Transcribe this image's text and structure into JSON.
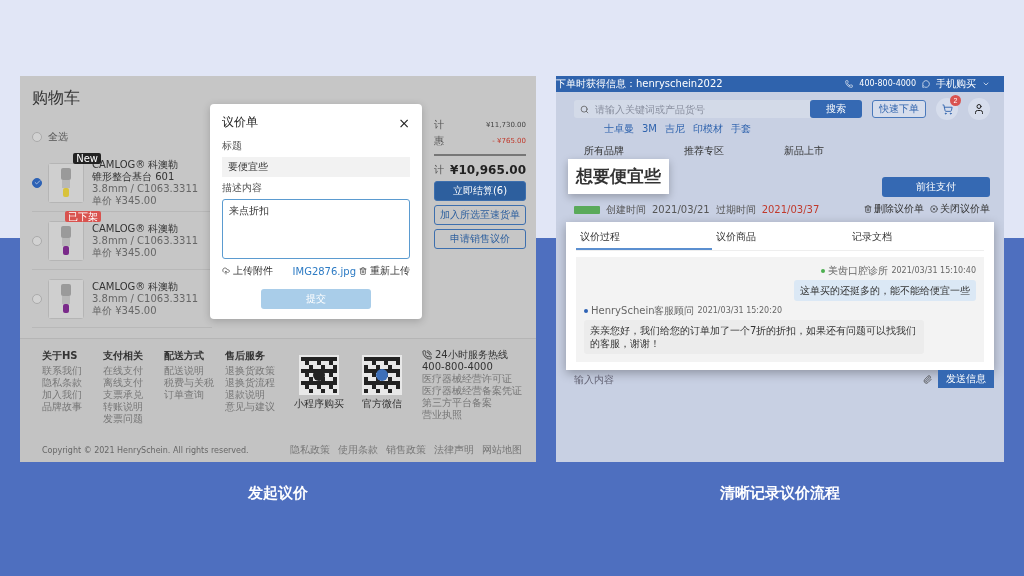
{
  "cart_screen": {
    "title": "购物车",
    "select_all": {
      "label": "全选",
      "checked": false
    },
    "products": [
      {
        "badge": {
          "text": "New",
          "color": "#222222"
        },
        "checked": true,
        "name": "CAMLOG® 科澳勒",
        "model": "锥形整合基台 601",
        "spec": "3.8mm / C1063.3311",
        "price": "单价 ¥345.00"
      },
      {
        "badge": {
          "text": "已下架",
          "color": "#d9534f"
        },
        "checked": false,
        "name": "CAMLOG® 科澳勒",
        "spec": "3.8mm / C1063.3311",
        "price": "单价 ¥345.00"
      },
      {
        "checked": false,
        "name": "CAMLOG® 科澳勒",
        "spec": "3.8mm / C1063.3311",
        "price": "单价 ¥345.00"
      }
    ],
    "summary": {
      "rows": [
        {
          "label": "计",
          "value": "¥11,730.00",
          "kind": "normal"
        },
        {
          "label": "惠",
          "value": "- ¥765.00",
          "kind": "discount"
        }
      ],
      "total_label": "计",
      "total": "¥10,965.00"
    },
    "buttons": [
      {
        "label": "立即结算(6)",
        "kind": "primary"
      },
      {
        "label": "加入所选至速货单",
        "kind": "outline"
      },
      {
        "label": "申请销售议价",
        "kind": "outline"
      }
    ],
    "dialog": {
      "title": "议价单",
      "close": "×",
      "title_label": "标题",
      "title_value": "要便宜些",
      "desc_label": "描述内容",
      "desc_value": "来点折扣",
      "upload": "上传附件",
      "file": "IMG2876.jpg",
      "reupload": "重新上传",
      "submit": {
        "label": "提交",
        "disabled": true
      }
    },
    "footer": {
      "columns": [
        {
          "heading": "关于HS",
          "links": [
            "联系我们",
            "隐私条款",
            "加入我们",
            "品牌故事"
          ]
        },
        {
          "heading": "支付相关",
          "links": [
            "在线支付",
            "离线支付",
            "支票承兑",
            "转账说明",
            "发票问题"
          ]
        },
        {
          "heading": "配送方式",
          "links": [
            "配送说明",
            "税费与关税",
            "订单查询"
          ]
        },
        {
          "heading": "售后服务",
          "links": [
            "退换货政策",
            "退换货流程",
            "退款说明",
            "意见与建议"
          ]
        }
      ],
      "qr_codes": [
        {
          "label": "小程序购买"
        },
        {
          "label": "官方微信"
        }
      ],
      "hotline": {
        "label": "24小时服务热线",
        "number": "400-800-4000",
        "links": [
          "医疗器械经营许可证",
          "医疗器械经营备案凭证",
          "第三方平台备案",
          "营业执照"
        ]
      },
      "copyright": "Copyright © 2021 HenrySchein. All rights reserved.",
      "legal_links": [
        "隐私政策",
        "使用条款",
        "销售政策",
        "法律声明",
        "网站地图"
      ]
    }
  },
  "negotiation_screen": {
    "top_bar": {
      "notice": "下单时获得信息：henryschein2022",
      "phone": "400-800-4000",
      "mobile": "手机购买"
    },
    "search": {
      "placeholder": "请输入关键词或产品货号",
      "button": "搜索"
    },
    "hot_words": [
      "士卓曼",
      "3M",
      "吉尼",
      "印模材",
      "手套"
    ],
    "quick_order": "快速下单",
    "cart_count": "2",
    "nav": [
      "所有品牌",
      "推荐专区",
      "新品上市"
    ],
    "callout": "想要便宜些",
    "created": {
      "label": "创建时间",
      "value": "2021/03/21"
    },
    "expires": {
      "label": "过期时间",
      "value": "2021/03/37"
    },
    "pay_button": "前往支付",
    "actions": [
      {
        "label": "删除议价单",
        "kind": "delete"
      },
      {
        "label": "关闭议价单",
        "kind": "close"
      }
    ],
    "tabs": [
      {
        "label": "议价过程",
        "selected": true
      },
      {
        "label": "议价商品",
        "selected": false
      },
      {
        "label": "记录文档",
        "selected": false
      }
    ],
    "messages": [
      {
        "kind": "sent",
        "color": "#4caf50",
        "sender": "美齿口腔诊所",
        "time": "2021/03/31 15:10:40",
        "text": "这单买的还挺多的，能不能给便宜一些"
      },
      {
        "kind": "received",
        "color": "#2d62b5",
        "sender": "HenrySchein客服顾问",
        "time": "2021/03/31 15:20:20",
        "text": "亲亲您好，我们给您的订单加了一个7折的折扣，如果还有问题可以找我们的客服，谢谢！"
      }
    ],
    "input_placeholder": "输入内容",
    "send_button": "发送信息"
  },
  "captions": [
    "发起议价",
    "清晰记录议价流程"
  ]
}
